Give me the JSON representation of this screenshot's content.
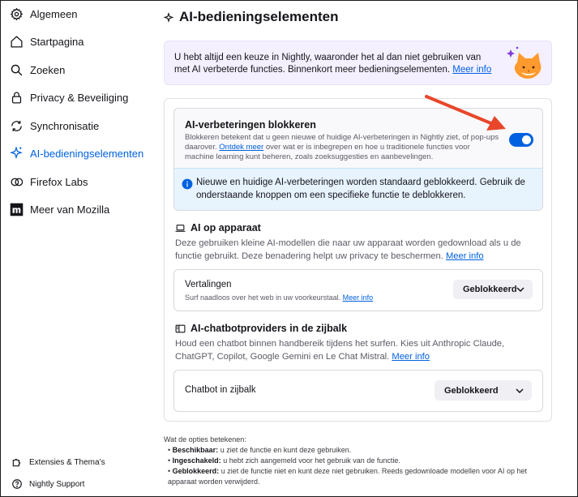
{
  "sidebar": {
    "items": [
      {
        "label": "Algemeen",
        "icon": "gear-icon"
      },
      {
        "label": "Startpagina",
        "icon": "home-icon"
      },
      {
        "label": "Zoeken",
        "icon": "search-icon"
      },
      {
        "label": "Privacy & Beveiliging",
        "icon": "lock-icon"
      },
      {
        "label": "Synchronisatie",
        "icon": "sync-icon"
      },
      {
        "label": "AI-bedieningselementen",
        "icon": "sparkle-icon",
        "active": true
      },
      {
        "label": "Firefox Labs",
        "icon": "flask-icon"
      },
      {
        "label": "Meer van Mozilla",
        "icon": "mozilla-icon"
      }
    ],
    "footer": [
      {
        "label": "Extensies & Thema’s",
        "icon": "puzzle-icon"
      },
      {
        "label": "Nightly Support",
        "icon": "help-icon"
      }
    ]
  },
  "main": {
    "title": "AI-bedieningselementen",
    "banner": {
      "text": "U hebt altijd een keuze in Nightly, waaronder het al dan niet gebruiken van met AI verbeterde functies. Binnenkort meer bedieningselementen.",
      "link": "Meer info"
    },
    "block": {
      "title": "AI-verbeteringen blokkeren",
      "desc_before": "Blokkeren betekent dat u geen nieuwe of huidige AI-verbeteringen in Nightly ziet, of pop-ups daarover.",
      "desc_link": "Ontdek meer",
      "desc_after": "over wat er is inbegrepen en hoe u traditionele functies voor machine learning kunt beheren, zoals zoeksuggesties en aanbevelingen.",
      "toggle_on": true,
      "info": "Nieuwe en huidige AI-verbeteringen worden standaard geblokkeerd. Gebruik de onderstaande knoppen om een specifieke functie te deblokkeren."
    },
    "device_ai": {
      "title": "AI op apparaat",
      "desc": "Deze gebruiken kleine AI-modellen die naar uw apparaat worden gedownload als u de functie gebruikt. Deze benadering helpt uw privacy te beschermen.",
      "link": "Meer info",
      "row": {
        "label": "Vertalingen",
        "sub": "Surf naadloos over het web in uw voorkeurstaal.",
        "sub_link": "Meer info",
        "value": "Geblokkeerd"
      }
    },
    "chatbot": {
      "title": "AI-chatbotproviders in de zijbalk",
      "desc": "Houd een chatbot binnen handbereik tijdens het surfen. Kies uit Anthropic Claude, ChatGPT, Copilot, Google Gemini en Le Chat Mistral.",
      "link": "Meer info",
      "row": {
        "label": "Chatbot in zijbalk",
        "value": "Geblokkeerd"
      }
    },
    "legend": {
      "intro": "Wat de opties betekenen:",
      "items": [
        {
          "term": "Beschikbaar:",
          "text": "u ziet de functie en kunt deze gebruiken."
        },
        {
          "term": "Ingeschakeld:",
          "text": "u hebt zich aangemeld voor het gebruik van de functie."
        },
        {
          "term": "Geblokkeerd:",
          "text": "u ziet de functie niet en kunt deze niet gebruiken. Reeds gedownloade modellen voor AI op het apparaat worden verwijderd."
        }
      ]
    }
  },
  "colors": {
    "accent": "#0061e0",
    "annotation_arrow": "#e8472b",
    "banner_bg": "#f4f0ff",
    "info_bg": "#e7f3fd"
  }
}
